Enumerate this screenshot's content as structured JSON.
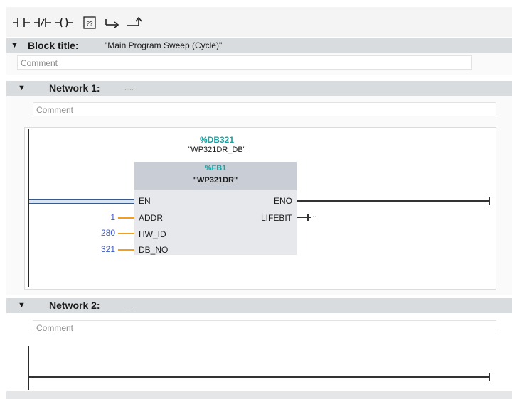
{
  "toolbar": {
    "buttons": [
      {
        "name": "normally-open-contact-icon",
        "glyph": "-|  |-"
      },
      {
        "name": "normally-closed-contact-icon",
        "glyph": "-|/|-"
      },
      {
        "name": "coil-icon",
        "glyph": "-( )-"
      },
      {
        "name": "empty-box-icon",
        "glyph": "??"
      },
      {
        "name": "open-branch-icon",
        "glyph": "↦"
      },
      {
        "name": "close-branch-icon",
        "glyph": "⤴"
      }
    ]
  },
  "block": {
    "title_label": "Block title:",
    "title_value": "\"Main Program Sweep (Cycle)\"",
    "comment_placeholder": "Comment"
  },
  "networks": [
    {
      "label": "Network 1:",
      "title_placeholder": ".....",
      "comment_placeholder": "Comment",
      "instance_db": "%DB321",
      "instance_db_name": "\"WP321DR_DB\"",
      "fb_number": "%FB1",
      "fb_name": "\"WP321DR\"",
      "inputs": [
        {
          "pin": "EN",
          "value": ""
        },
        {
          "pin": "ADDR",
          "value": "1"
        },
        {
          "pin": "HW_ID",
          "value": "280"
        },
        {
          "pin": "DB_NO",
          "value": "321"
        }
      ],
      "outputs": [
        {
          "pin": "ENO"
        },
        {
          "pin": "LIFEBIT",
          "value": "..."
        }
      ]
    },
    {
      "label": "Network 2:",
      "title_placeholder": ".....",
      "comment_placeholder": "Comment"
    }
  ],
  "colors": {
    "teal": "#1aa3a3",
    "param_blue": "#3b5bcc",
    "param_orange": "#f0a020",
    "header_bg": "#d9dcde"
  }
}
